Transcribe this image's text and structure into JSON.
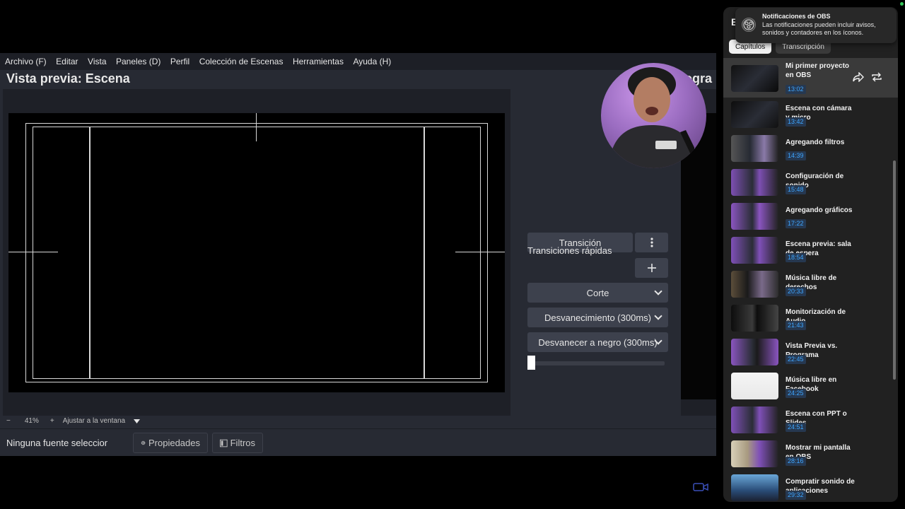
{
  "obs": {
    "menu": [
      "Archivo (F)",
      "Editar",
      "Vista",
      "Paneles (D)",
      "Perfil",
      "Colección de Escenas",
      "Herramientas",
      "Ayuda (H)"
    ],
    "preview_title": "Vista previa: Escena",
    "program_title_fragment": "ogra",
    "zoom": {
      "minus": "−",
      "percent": "41%",
      "plus": "+",
      "fit_label": "Ajustar a la ventana"
    },
    "source_status": "Ninguna fuente seleccionad",
    "properties_button": "Propiedades",
    "filters_button": "Filtros",
    "transitions": {
      "transition_button": "Transición",
      "quick_transitions_label": "Transiciones rápidas",
      "options": [
        "Corte",
        "Desvanecimiento (300ms)",
        "Desvanecer a negro (300ms)"
      ],
      "slider_value": 0
    }
  },
  "notification": {
    "title": "Notificaciones de OBS",
    "body": "Las notificaciones pueden incluir avisos, sonidos y contadores en los íconos."
  },
  "chapters_panel": {
    "header_letter": "E",
    "tabs": [
      "Capítulos",
      "Transcripción"
    ],
    "chapters": [
      {
        "title": "Mi primer proyecto en OBS",
        "time": "13:02"
      },
      {
        "title": "Escena con cámara y micro",
        "time": "13:42"
      },
      {
        "title": "Agregando filtros",
        "time": "14:39"
      },
      {
        "title": "Configuración de sonido",
        "time": "15:48"
      },
      {
        "title": "Agregando gráficos",
        "time": "17:22"
      },
      {
        "title": "Escena previa: sala de espera",
        "time": "18:54"
      },
      {
        "title": "Música libre de derechos",
        "time": "20:33"
      },
      {
        "title": "Monitorización de Audio",
        "time": "21:43"
      },
      {
        "title": "Vista Previa vs. Programa",
        "time": "22:45"
      },
      {
        "title": "Música libre en Facebook",
        "time": "24:25"
      },
      {
        "title": "Escena con PPT o Slides",
        "time": "24:51"
      },
      {
        "title": "Mostrar mi pantalla en OBS",
        "time": "28:16"
      },
      {
        "title": "Compratir sonido de aplicaciones",
        "time": "29:32"
      }
    ]
  }
}
